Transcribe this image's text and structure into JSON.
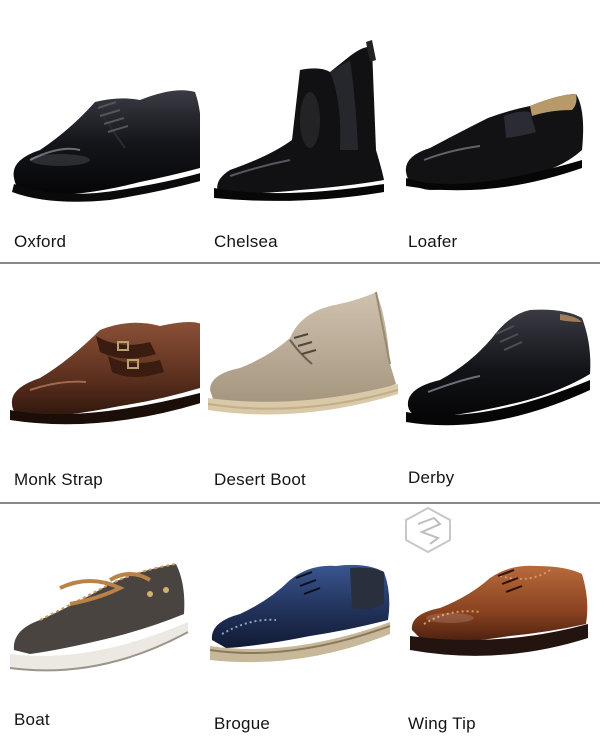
{
  "rows": [
    {
      "items": [
        {
          "label": "Oxford"
        },
        {
          "label": "Chelsea"
        },
        {
          "label": "Loafer"
        }
      ]
    },
    {
      "items": [
        {
          "label": "Monk Strap"
        },
        {
          "label": "Desert Boot"
        },
        {
          "label": "Derby"
        }
      ]
    },
    {
      "items": [
        {
          "label": "Boat"
        },
        {
          "label": "Brogue"
        },
        {
          "label": "Wing Tip"
        }
      ]
    }
  ],
  "colors": {
    "black_leather": "#111114",
    "brown_leather": "#5a2f1e",
    "suede": "#b7a892",
    "boat_leather": "#4a4440",
    "navy_leather": "#1f2f55",
    "tan_leather": "#8a4220",
    "divider": "#8a8a8a"
  }
}
